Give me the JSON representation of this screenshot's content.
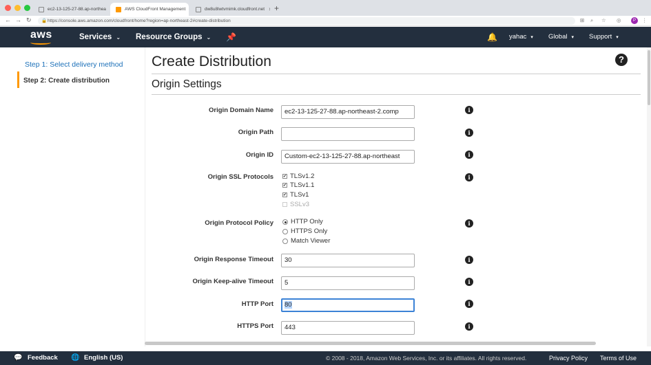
{
  "browser": {
    "tabs": [
      {
        "label": "ec2-13-125-27-88.ap-northea"
      },
      {
        "label": "AWS CloudFront Management"
      },
      {
        "label": "dw8u8lwtvmimk.cloudfront.net"
      }
    ],
    "url": "https://console.aws.amazon.com/cloudfront/home?region=ap-northeast-2#create-distribution"
  },
  "header": {
    "logo": "aws",
    "services": "Services",
    "resource_groups": "Resource Groups",
    "user": "yahac",
    "region": "Global",
    "support": "Support"
  },
  "sidebar": {
    "step1": "Step 1: Select delivery method",
    "step2": "Step 2: Create distribution"
  },
  "main": {
    "title": "Create Distribution",
    "section": "Origin Settings"
  },
  "form": {
    "origin_domain_name": {
      "label": "Origin Domain Name",
      "value": "ec2-13-125-27-88.ap-northeast-2.comp"
    },
    "origin_path": {
      "label": "Origin Path",
      "value": ""
    },
    "origin_id": {
      "label": "Origin ID",
      "value": "Custom-ec2-13-125-27-88.ap-northeast"
    },
    "ssl": {
      "label": "Origin SSL Protocols",
      "options": [
        {
          "label": "TLSv1.2",
          "checked": true
        },
        {
          "label": "TLSv1.1",
          "checked": true
        },
        {
          "label": "TLSv1",
          "checked": true
        },
        {
          "label": "SSLv3",
          "checked": false,
          "disabled": true
        }
      ]
    },
    "protocol_policy": {
      "label": "Origin Protocol Policy",
      "options": [
        {
          "label": "HTTP Only",
          "selected": true
        },
        {
          "label": "HTTPS Only",
          "selected": false
        },
        {
          "label": "Match Viewer",
          "selected": false
        }
      ]
    },
    "response_timeout": {
      "label": "Origin Response Timeout",
      "value": "30"
    },
    "keepalive_timeout": {
      "label": "Origin Keep-alive Timeout",
      "value": "5"
    },
    "http_port": {
      "label": "HTTP Port",
      "value": "80"
    },
    "https_port": {
      "label": "HTTPS Port",
      "value": "443"
    }
  },
  "footer": {
    "feedback": "Feedback",
    "language": "English (US)",
    "copyright": "© 2008 - 2018, Amazon Web Services, Inc. or its affiliates. All rights reserved.",
    "privacy": "Privacy Policy",
    "terms": "Terms of Use"
  }
}
